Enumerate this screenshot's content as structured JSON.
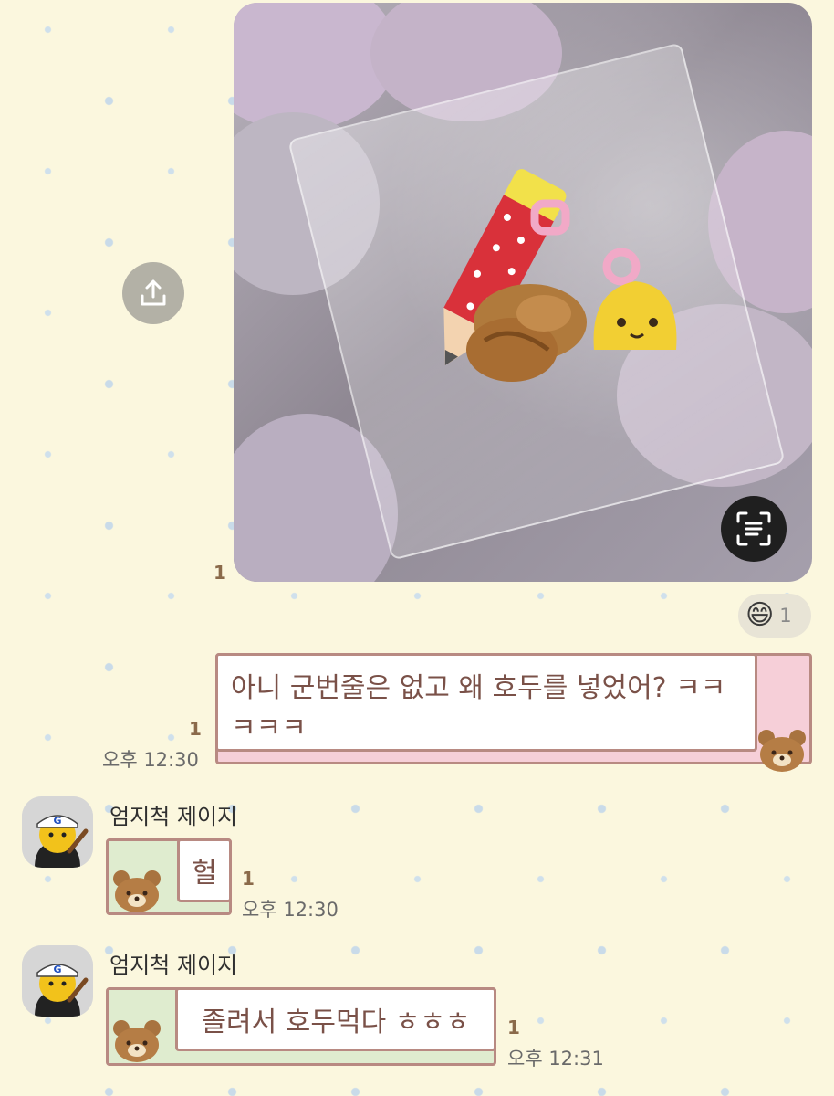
{
  "messages": {
    "photo": {
      "unread": "1",
      "reaction": {
        "emoji": "😄",
        "count": "1"
      }
    },
    "mine": {
      "text": "아니 군번줄은 없고 왜 호두를 넣었어? ㅋㅋㅋㅋㅋ",
      "unread": "1",
      "time": "오후 12:30"
    },
    "reply1": {
      "sender": "엄지척 제이지",
      "text": "헐",
      "unread": "1",
      "time": "오후 12:30"
    },
    "reply2": {
      "sender": "엄지척 제이지",
      "text": "졸려서 호두먹다 ㅎㅎㅎ",
      "unread": "1",
      "time": "오후 12:31"
    }
  },
  "icons": {
    "share": "share-icon",
    "scan": "text-scan-icon",
    "sticker": "bear-sticker-icon",
    "avatar": "profile-avatar"
  },
  "colors": {
    "background": "#fbf7de",
    "bubble_border": "#b88a82",
    "my_bubble_accent": "#f6cfd8",
    "their_bubble_accent": "#dfeccf",
    "text": "#7a5148"
  }
}
